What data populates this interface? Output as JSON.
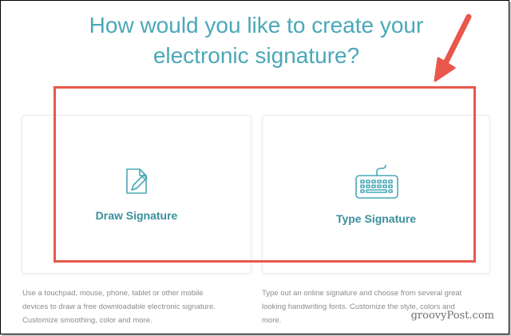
{
  "title_line1": "How would you like to create your",
  "title_line2": "electronic signature?",
  "options": [
    {
      "label": "Draw Signature",
      "icon": "pencil-document-icon",
      "description_lines": [
        "Use a touchpad, mouse, phone, tablet or other mobile",
        "devices to draw a free downloadable electronic signature.",
        "Customize smoothing, color and more."
      ]
    },
    {
      "label": "Type Signature",
      "icon": "keyboard-icon",
      "description_lines": [
        "Type out an online signature and choose from several great",
        "looking handwriting fonts. Customize the style, colors and",
        "more."
      ]
    }
  ],
  "watermark": "groovyPost.com",
  "colors": {
    "accent": "#4aa8b8",
    "label": "#3a8f9c",
    "highlight": "#e9574c",
    "description": "#8c8c8c"
  }
}
